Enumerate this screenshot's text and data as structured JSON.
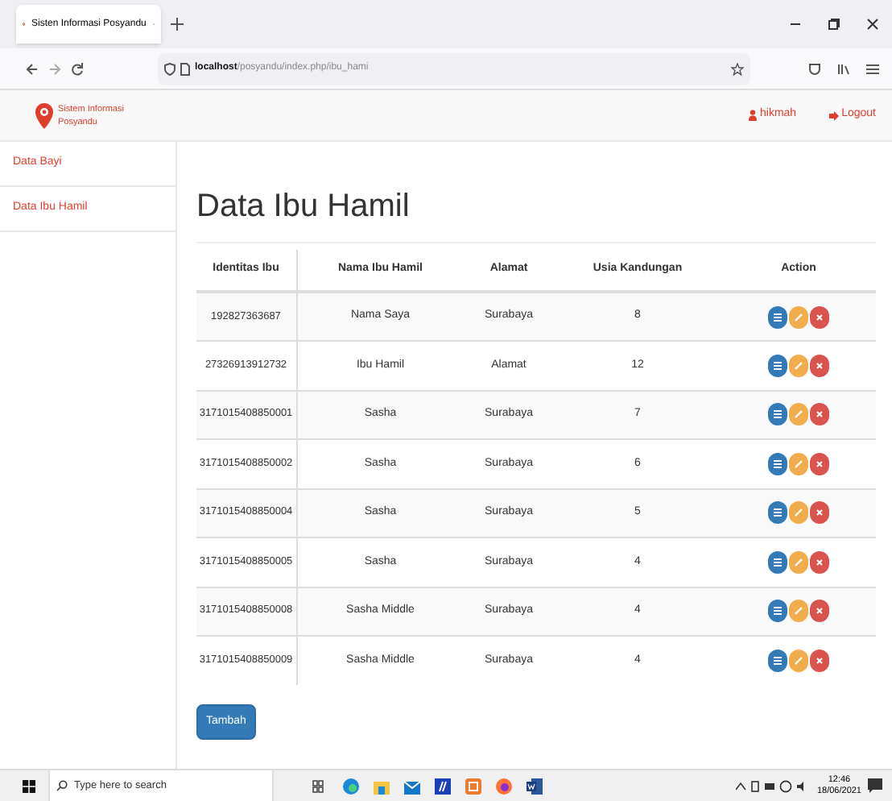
{
  "browser": {
    "tab_title": "Sisten Informasi Posyandu",
    "url_host": "localhost",
    "url_path": "/posyandu/index.php/ibu_hami"
  },
  "navbar": {
    "brand": [
      "Sistem Informasi",
      "Posyandu"
    ],
    "user": "hikmah",
    "logout": "Logout"
  },
  "sidebar": {
    "items": [
      {
        "label": "Data Bayi"
      },
      {
        "label": "Data Ibu Hamil"
      }
    ]
  },
  "page_title": "Data Ibu Hamil",
  "table": {
    "columns": [
      "Identitas Ibu",
      "Nama Ibu Hamil",
      "Alamat",
      "Usia Kandungan",
      "Action"
    ],
    "rows": [
      [
        "192827363687",
        "Nama Saya",
        "Surabaya",
        "8"
      ],
      [
        "27326913912732",
        "Ibu Hamil",
        "Alamat",
        "12"
      ],
      [
        "3171015408850001",
        "Sasha",
        "Surabaya",
        "7"
      ],
      [
        "3171015408850002",
        "Sasha",
        "Surabaya",
        "6"
      ],
      [
        "3171015408850004",
        "Sasha",
        "Surabaya",
        "5"
      ],
      [
        "3171015408850005",
        "Sasha",
        "Surabaya",
        "4"
      ],
      [
        "3171015408850008",
        "Sasha Middle",
        "Surabaya",
        "4"
      ],
      [
        "3171015408850009",
        "Sasha Middle",
        "Surabaya",
        "4"
      ]
    ]
  },
  "add_button": "Tambah",
  "taskbar": {
    "search_placeholder": "Type here to search",
    "time": "12:46",
    "date": "18/06/2021"
  }
}
